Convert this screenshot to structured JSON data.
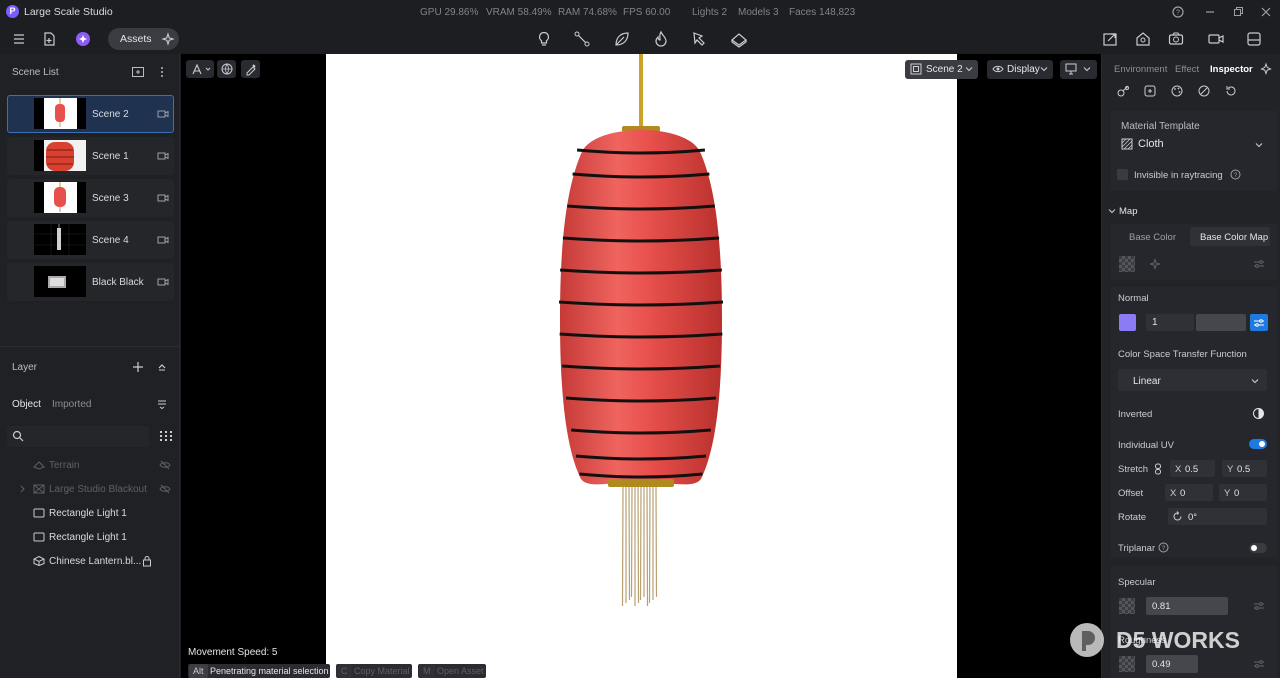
{
  "app": {
    "title": "Large Scale Studio",
    "logo_letter": "P"
  },
  "stats": {
    "gpu": "GPU 29.86%",
    "vram": "VRAM 58.49%",
    "ram": "RAM 74.68%",
    "fps": "FPS 60.00",
    "lights": "Lights 2",
    "models": "Models 3",
    "faces": "Faces 148,823"
  },
  "toolbar": {
    "assets_label": "Assets"
  },
  "scene_list": {
    "title": "Scene List",
    "scenes": [
      {
        "name": "Scene 2",
        "active": true
      },
      {
        "name": "Scene 1",
        "active": false
      },
      {
        "name": "Scene 3",
        "active": false
      },
      {
        "name": "Scene 4",
        "active": false
      },
      {
        "name": "Black Black",
        "active": false
      }
    ]
  },
  "layer": {
    "title": "Layer",
    "tabs": [
      "Object",
      "Imported"
    ],
    "items": [
      {
        "name": "Terrain",
        "icon": "terrain-icon",
        "dimmed": true
      },
      {
        "name": "Large Studio Blackout",
        "icon": "blackout-icon",
        "dimmed": true
      },
      {
        "name": "Rectangle Light 1",
        "icon": "rect-light-icon",
        "dimmed": false
      },
      {
        "name": "Rectangle Light 1",
        "icon": "rect-light-icon",
        "dimmed": false
      },
      {
        "name": "Chinese Lantern.bl...",
        "icon": "cube-icon",
        "dimmed": false
      }
    ]
  },
  "viewport": {
    "scene_selector": "Scene 2",
    "display_label": "Display",
    "movement_speed": "Movement Speed: 5",
    "hints": [
      {
        "key": "Alt",
        "label": "Penetrating material selection",
        "enabled": true
      },
      {
        "key": "C",
        "label": "Copy Material",
        "enabled": false
      },
      {
        "key": "M",
        "label": "Open Asset",
        "enabled": false
      }
    ]
  },
  "inspector": {
    "tabs": [
      "Environment",
      "Effect",
      "Inspector"
    ],
    "active_tab": "Inspector",
    "material_template_label": "Material Template",
    "material_template_value": "Cloth",
    "invisible_raytracing": "Invisible in raytracing",
    "map_section": "Map",
    "map_tabs": [
      "Base Color",
      "Base Color Map"
    ],
    "normal_label": "Normal",
    "normal_value": "1",
    "normal_swatch": "#8b7cf6",
    "color_space_label": "Color Space Transfer Function",
    "color_space_value": "Linear",
    "inverted_label": "Inverted",
    "individual_uv_label": "Individual UV",
    "individual_uv_on": true,
    "stretch_label": "Stretch",
    "stretch_x": "0.5",
    "stretch_y": "0.5",
    "offset_label": "Offset",
    "offset_x": "0",
    "offset_y": "0",
    "axis_x": "X",
    "axis_y": "Y",
    "rotate_label": "Rotate",
    "rotate_value": "0°",
    "triplanar_label": "Triplanar",
    "triplanar_on": false,
    "specular_label": "Specular",
    "specular_value": "0.81",
    "roughness_label": "Roughness",
    "roughness_value": "0.49",
    "accent": "#1f7ae0"
  },
  "watermark": {
    "text": "D5 WORKS"
  },
  "lantern": {
    "body_color": "#e8504c",
    "rib_color": "#111111",
    "brass_color": "#c9a227"
  }
}
